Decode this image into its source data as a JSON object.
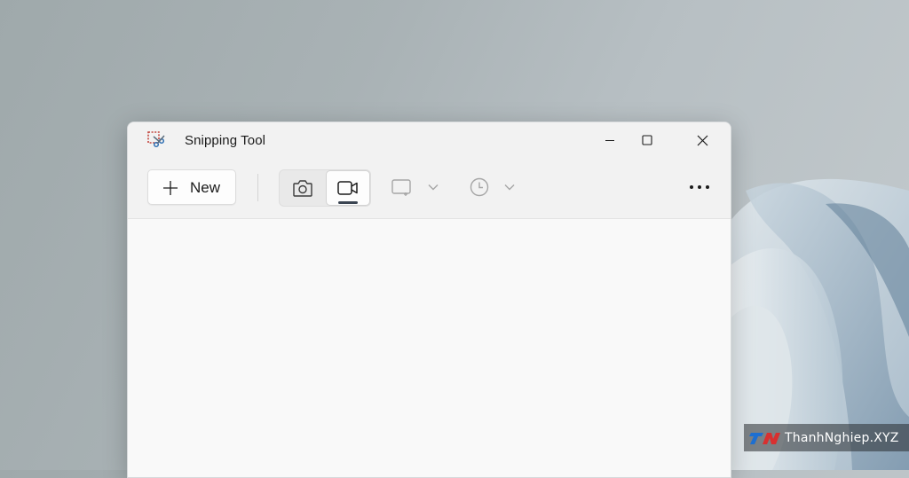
{
  "window": {
    "title": "Snipping Tool"
  },
  "toolbar": {
    "new_label": "New",
    "icons": {
      "new": "plus-icon",
      "snip_mode": "camera-icon",
      "record_mode": "video-camera-icon",
      "shape": "rectangle-select-icon",
      "delay": "clock-icon",
      "more": "more-horizontal-icon"
    },
    "selected_mode": "record"
  },
  "watermark": {
    "logo_text": "TN",
    "text": "ThanhNghiep.XYZ"
  },
  "colors": {
    "accent_indicator": "#3a4451",
    "window_bg": "#f9f9f9",
    "titlebar_bg": "#f2f2f2"
  }
}
